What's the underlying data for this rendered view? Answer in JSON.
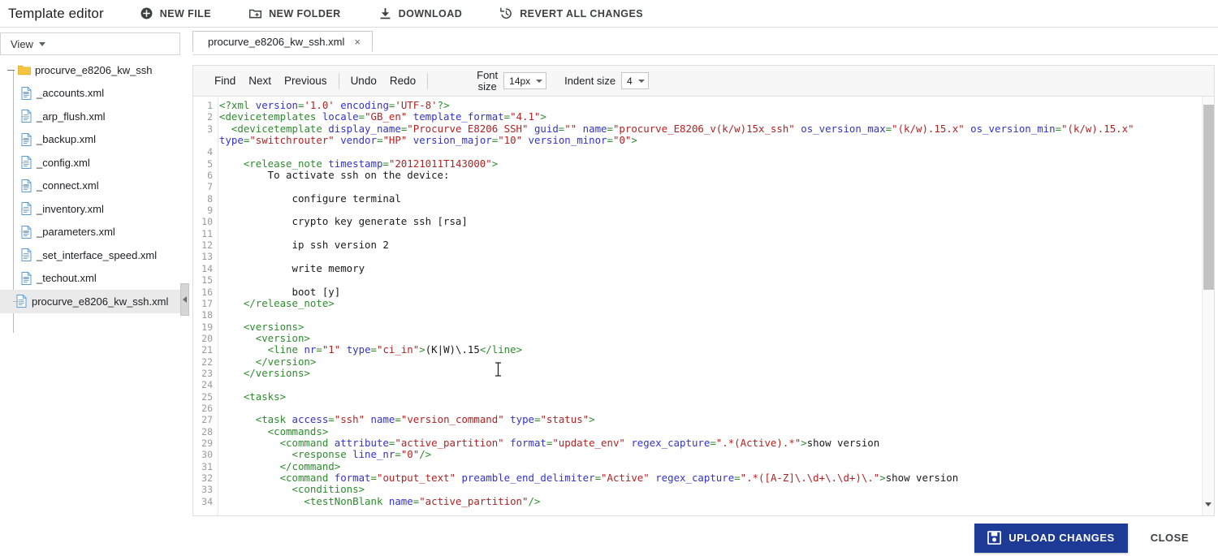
{
  "header": {
    "title": "Template editor",
    "actions": [
      {
        "label": "NEW FILE",
        "icon": "plus-circle-icon"
      },
      {
        "label": "NEW FOLDER",
        "icon": "folder-plus-icon"
      },
      {
        "label": "DOWNLOAD",
        "icon": "download-icon"
      },
      {
        "label": "REVERT ALL CHANGES",
        "icon": "revert-history-icon"
      }
    ]
  },
  "sidebar": {
    "view_label": "View",
    "root": {
      "label": "procurve_e8206_kw_ssh",
      "icon": "folder-icon"
    },
    "files": [
      "_accounts.xml",
      "_arp_flush.xml",
      "_backup.xml",
      "_config.xml",
      "_connect.xml",
      "_inventory.xml",
      "_parameters.xml",
      "_set_interface_speed.xml",
      "_techout.xml"
    ],
    "selected_file": "procurve_e8206_kw_ssh.xml"
  },
  "editor": {
    "tab": {
      "label": "procurve_e8206_kw_ssh.xml",
      "close": "×"
    },
    "toolbar": {
      "find": "Find",
      "next": "Next",
      "previous": "Previous",
      "undo": "Undo",
      "redo": "Redo",
      "font_size_label_line1": "Font",
      "font_size_label_line2": "size",
      "font_size_value": "14px",
      "indent_size_label": "Indent size",
      "indent_size_value": "4"
    },
    "line_numbers": [
      "1",
      "2",
      "3",
      "4",
      "5",
      "6",
      "7",
      "8",
      "9",
      "10",
      "11",
      "12",
      "13",
      "14",
      "15",
      "16",
      "17",
      "18",
      "19",
      "20",
      "21",
      "22",
      "23",
      "24",
      "25",
      "26",
      "27",
      "28",
      "29",
      "30",
      "31",
      "32",
      "33",
      "34"
    ],
    "code_lines": [
      {
        "n": 1,
        "wrap": false,
        "tokens": [
          {
            "c": "t",
            "s": "<?xml "
          },
          {
            "c": "a",
            "s": "version"
          },
          {
            "c": "t",
            "s": "="
          },
          {
            "c": "v",
            "s": "'1.0'"
          },
          {
            "c": "t",
            "s": " "
          },
          {
            "c": "a",
            "s": "encoding"
          },
          {
            "c": "t",
            "s": "="
          },
          {
            "c": "v",
            "s": "'UTF-8'"
          },
          {
            "c": "t",
            "s": "?>"
          }
        ]
      },
      {
        "n": 2,
        "wrap": false,
        "tokens": [
          {
            "c": "t",
            "s": "<devicetemplates "
          },
          {
            "c": "a",
            "s": "locale"
          },
          {
            "c": "t",
            "s": "="
          },
          {
            "c": "v",
            "s": "\"GB_en\""
          },
          {
            "c": "t",
            "s": " "
          },
          {
            "c": "a",
            "s": "template_format"
          },
          {
            "c": "t",
            "s": "="
          },
          {
            "c": "v",
            "s": "\"4.1\""
          },
          {
            "c": "t",
            "s": ">"
          }
        ]
      },
      {
        "n": 3,
        "wrap": true,
        "tokens": [
          {
            "c": "t",
            "s": "  <devicetemplate "
          },
          {
            "c": "a",
            "s": "display_name"
          },
          {
            "c": "t",
            "s": "="
          },
          {
            "c": "v",
            "s": "\"Procurve E8206 SSH\""
          },
          {
            "c": "t",
            "s": " "
          },
          {
            "c": "a",
            "s": "guid"
          },
          {
            "c": "t",
            "s": "="
          },
          {
            "c": "v",
            "s": "\"\""
          },
          {
            "c": "t",
            "s": " "
          },
          {
            "c": "a",
            "s": "name"
          },
          {
            "c": "t",
            "s": "="
          },
          {
            "c": "v",
            "s": "\"procurve_E8206_v(k/w)15x_ssh\""
          },
          {
            "c": "t",
            "s": " "
          },
          {
            "c": "a",
            "s": "os_version_max"
          },
          {
            "c": "t",
            "s": "="
          },
          {
            "c": "v",
            "s": "\"(k/w).15.x\""
          },
          {
            "c": "t",
            "s": " "
          },
          {
            "c": "a",
            "s": "os_version_min"
          },
          {
            "c": "t",
            "s": "="
          },
          {
            "c": "v",
            "s": "\"(k/w).15.x\""
          },
          {
            "c": "t",
            "s": " "
          },
          {
            "c": "a",
            "s": "type"
          },
          {
            "c": "t",
            "s": "="
          },
          {
            "c": "v",
            "s": "\"switchrouter\""
          },
          {
            "c": "t",
            "s": " "
          },
          {
            "c": "a",
            "s": "vendor"
          },
          {
            "c": "t",
            "s": "="
          },
          {
            "c": "v",
            "s": "\"HP\""
          },
          {
            "c": "t",
            "s": " "
          },
          {
            "c": "a",
            "s": "version_major"
          },
          {
            "c": "t",
            "s": "="
          },
          {
            "c": "v",
            "s": "\"10\""
          },
          {
            "c": "t",
            "s": " "
          },
          {
            "c": "a",
            "s": "version_minor"
          },
          {
            "c": "t",
            "s": "="
          },
          {
            "c": "v",
            "s": "\"0\""
          },
          {
            "c": "t",
            "s": ">"
          }
        ]
      },
      {
        "n": 4,
        "wrap": false,
        "tokens": []
      },
      {
        "n": 5,
        "wrap": false,
        "tokens": [
          {
            "c": "t",
            "s": "    <release_note "
          },
          {
            "c": "a",
            "s": "timestamp"
          },
          {
            "c": "t",
            "s": "="
          },
          {
            "c": "v",
            "s": "\"20121011T143000\""
          },
          {
            "c": "t",
            "s": ">"
          }
        ]
      },
      {
        "n": 6,
        "wrap": false,
        "tokens": [
          {
            "c": "p",
            "s": "        To activate ssh on the device:"
          }
        ]
      },
      {
        "n": 7,
        "wrap": false,
        "tokens": []
      },
      {
        "n": 8,
        "wrap": false,
        "tokens": [
          {
            "c": "p",
            "s": "            configure terminal"
          }
        ]
      },
      {
        "n": 9,
        "wrap": false,
        "tokens": []
      },
      {
        "n": 10,
        "wrap": false,
        "tokens": [
          {
            "c": "p",
            "s": "            crypto key generate ssh [rsa]"
          }
        ]
      },
      {
        "n": 11,
        "wrap": false,
        "tokens": []
      },
      {
        "n": 12,
        "wrap": false,
        "tokens": [
          {
            "c": "p",
            "s": "            ip ssh version 2"
          }
        ]
      },
      {
        "n": 13,
        "wrap": false,
        "tokens": []
      },
      {
        "n": 14,
        "wrap": false,
        "tokens": [
          {
            "c": "p",
            "s": "            write memory"
          }
        ]
      },
      {
        "n": 15,
        "wrap": false,
        "tokens": []
      },
      {
        "n": 16,
        "wrap": false,
        "tokens": [
          {
            "c": "p",
            "s": "            boot [y]"
          }
        ]
      },
      {
        "n": 17,
        "wrap": false,
        "tokens": [
          {
            "c": "t",
            "s": "    </release_note>"
          }
        ]
      },
      {
        "n": 18,
        "wrap": false,
        "tokens": []
      },
      {
        "n": 19,
        "wrap": false,
        "tokens": [
          {
            "c": "t",
            "s": "    <versions>"
          }
        ]
      },
      {
        "n": 20,
        "wrap": false,
        "tokens": [
          {
            "c": "t",
            "s": "      <version>"
          }
        ]
      },
      {
        "n": 21,
        "wrap": false,
        "tokens": [
          {
            "c": "t",
            "s": "        <line "
          },
          {
            "c": "a",
            "s": "nr"
          },
          {
            "c": "t",
            "s": "="
          },
          {
            "c": "v",
            "s": "\"1\""
          },
          {
            "c": "t",
            "s": " "
          },
          {
            "c": "a",
            "s": "type"
          },
          {
            "c": "t",
            "s": "="
          },
          {
            "c": "v",
            "s": "\"ci_in\""
          },
          {
            "c": "t",
            "s": ">"
          },
          {
            "c": "p",
            "s": "(K|W)\\.15"
          },
          {
            "c": "t",
            "s": "</line>"
          }
        ]
      },
      {
        "n": 22,
        "wrap": false,
        "tokens": [
          {
            "c": "t",
            "s": "      </version>"
          }
        ]
      },
      {
        "n": 23,
        "wrap": false,
        "tokens": [
          {
            "c": "t",
            "s": "    </versions>"
          }
        ]
      },
      {
        "n": 24,
        "wrap": false,
        "tokens": []
      },
      {
        "n": 25,
        "wrap": false,
        "tokens": [
          {
            "c": "t",
            "s": "    <tasks>"
          }
        ]
      },
      {
        "n": 26,
        "wrap": false,
        "tokens": []
      },
      {
        "n": 27,
        "wrap": false,
        "tokens": [
          {
            "c": "t",
            "s": "      <task "
          },
          {
            "c": "a",
            "s": "access"
          },
          {
            "c": "t",
            "s": "="
          },
          {
            "c": "v",
            "s": "\"ssh\""
          },
          {
            "c": "t",
            "s": " "
          },
          {
            "c": "a",
            "s": "name"
          },
          {
            "c": "t",
            "s": "="
          },
          {
            "c": "v",
            "s": "\"version_command\""
          },
          {
            "c": "t",
            "s": " "
          },
          {
            "c": "a",
            "s": "type"
          },
          {
            "c": "t",
            "s": "="
          },
          {
            "c": "v",
            "s": "\"status\""
          },
          {
            "c": "t",
            "s": ">"
          }
        ]
      },
      {
        "n": 28,
        "wrap": false,
        "tokens": [
          {
            "c": "t",
            "s": "        <commands>"
          }
        ]
      },
      {
        "n": 29,
        "wrap": false,
        "tokens": [
          {
            "c": "t",
            "s": "          <command "
          },
          {
            "c": "a",
            "s": "attribute"
          },
          {
            "c": "t",
            "s": "="
          },
          {
            "c": "v",
            "s": "\"active_partition\""
          },
          {
            "c": "t",
            "s": " "
          },
          {
            "c": "a",
            "s": "format"
          },
          {
            "c": "t",
            "s": "="
          },
          {
            "c": "v",
            "s": "\"update_env\""
          },
          {
            "c": "t",
            "s": " "
          },
          {
            "c": "a",
            "s": "regex_capture"
          },
          {
            "c": "t",
            "s": "="
          },
          {
            "c": "v",
            "s": "\".*(Active).*\""
          },
          {
            "c": "t",
            "s": ">"
          },
          {
            "c": "p",
            "s": "show version"
          }
        ]
      },
      {
        "n": 30,
        "wrap": false,
        "tokens": [
          {
            "c": "t",
            "s": "            <response "
          },
          {
            "c": "a",
            "s": "line_nr"
          },
          {
            "c": "t",
            "s": "="
          },
          {
            "c": "v",
            "s": "\"0\""
          },
          {
            "c": "t",
            "s": "/>"
          }
        ]
      },
      {
        "n": 31,
        "wrap": false,
        "tokens": [
          {
            "c": "t",
            "s": "          </command>"
          }
        ]
      },
      {
        "n": 32,
        "wrap": false,
        "tokens": [
          {
            "c": "t",
            "s": "          <command "
          },
          {
            "c": "a",
            "s": "format"
          },
          {
            "c": "t",
            "s": "="
          },
          {
            "c": "v",
            "s": "\"output_text\""
          },
          {
            "c": "t",
            "s": " "
          },
          {
            "c": "a",
            "s": "preamble_end_delimiter"
          },
          {
            "c": "t",
            "s": "="
          },
          {
            "c": "v",
            "s": "\"Active\""
          },
          {
            "c": "t",
            "s": " "
          },
          {
            "c": "a",
            "s": "regex_capture"
          },
          {
            "c": "t",
            "s": "="
          },
          {
            "c": "v",
            "s": "\".*([A-Z]\\.\\d+\\.\\d+)\\.\""
          },
          {
            "c": "t",
            "s": ">"
          },
          {
            "c": "p",
            "s": "show version"
          }
        ]
      },
      {
        "n": 33,
        "wrap": false,
        "tokens": [
          {
            "c": "t",
            "s": "            <conditions>"
          }
        ]
      },
      {
        "n": 34,
        "wrap": false,
        "tokens": [
          {
            "c": "t",
            "s": "              <testNonBlank "
          },
          {
            "c": "a",
            "s": "name"
          },
          {
            "c": "t",
            "s": "="
          },
          {
            "c": "v",
            "s": "\"active_partition\""
          },
          {
            "c": "t",
            "s": "/>"
          }
        ]
      }
    ]
  },
  "footer": {
    "upload_label": "UPLOAD CHANGES",
    "upload_icon": "save-floppy-icon",
    "close_label": "CLOSE",
    "upload_color": "#1e3a97"
  }
}
